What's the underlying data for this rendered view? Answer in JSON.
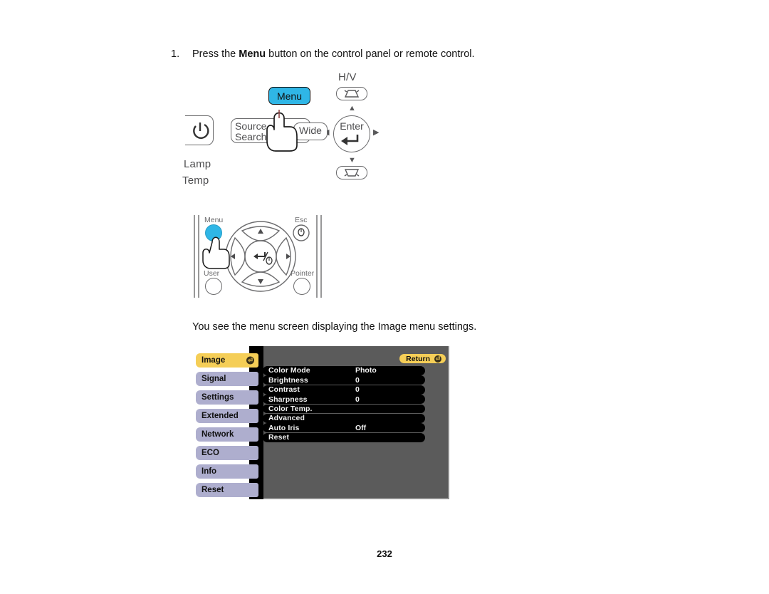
{
  "step": {
    "number": "1.",
    "text_before": "Press the ",
    "bold_word": "Menu",
    "text_after": " button on the control panel or remote control."
  },
  "control_panel": {
    "menu_button": "Menu",
    "power_icon": "power-icon",
    "source_search": "Source\nSearch",
    "source_search_line1": "Source",
    "source_search_line2": "Search",
    "wide_button": "Wide",
    "indicator_lamp": "Lamp",
    "indicator_temp": "Temp",
    "keystone_label": "H/V",
    "enter_button": "Enter",
    "keystone_up_icon": "keystone-up-icon",
    "keystone_down_icon": "keystone-down-icon",
    "arrow_up": "▲",
    "arrow_down": "▼",
    "arrow_left": "◀",
    "arrow_right": "▶",
    "hand_icon": "pointing-hand-icon"
  },
  "remote": {
    "menu_button": "Menu",
    "esc_button": "Esc",
    "user_button": "User",
    "pointer_button": "Pointer",
    "arrow_up": "▲",
    "arrow_down": "▼",
    "arrow_left": "◀",
    "arrow_right": "▶",
    "enter_icon": "enter-arrow-icon",
    "hand_icon": "pointing-hand-icon"
  },
  "paragraph": "You see the menu screen displaying the Image menu settings.",
  "osd": {
    "return_label": "Return",
    "return_icon": "enter-circle-icon",
    "active_tab_icon": "enter-circle-icon",
    "tabs": [
      {
        "label": "Image",
        "active": true
      },
      {
        "label": "Signal",
        "active": false
      },
      {
        "label": "Settings",
        "active": false
      },
      {
        "label": "Extended",
        "active": false
      },
      {
        "label": "Network",
        "active": false
      },
      {
        "label": "ECO",
        "active": false
      },
      {
        "label": "Info",
        "active": false
      },
      {
        "label": "Reset",
        "active": false
      }
    ],
    "items": [
      {
        "name": "Color Mode",
        "value": "Photo"
      },
      {
        "name": "Brightness",
        "value": "0"
      },
      {
        "name": "Contrast",
        "value": "0"
      },
      {
        "name": "Sharpness",
        "value": "0"
      },
      {
        "name": "Color Temp.",
        "value": ""
      },
      {
        "name": "Advanced",
        "value": ""
      },
      {
        "name": "Auto Iris",
        "value": "Off"
      },
      {
        "name": "Reset",
        "value": ""
      }
    ],
    "colors": {
      "active_tab": "#f5ce57",
      "tab": "#aeaece",
      "panel": "#5b5b5b",
      "row": "#000000"
    }
  },
  "footer": {
    "page_number": "232"
  }
}
